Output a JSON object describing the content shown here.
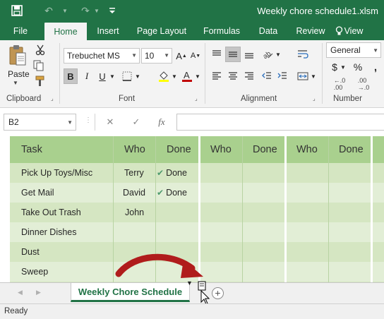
{
  "titlebar": {
    "document_title": "Weekly chore schedule1.xlsm",
    "icons": [
      "save-icon",
      "undo-icon",
      "redo-icon",
      "customize-qat-icon"
    ]
  },
  "ribbon_tabs": [
    "File",
    "Home",
    "Insert",
    "Page Layout",
    "Formulas",
    "Data",
    "Review",
    "View"
  ],
  "active_tab": "Home",
  "ribbon": {
    "clipboard": {
      "label": "Clipboard",
      "paste_label": "Paste"
    },
    "font": {
      "label": "Font",
      "font_name": "Trebuchet MS",
      "font_size": "10",
      "bold": true
    },
    "alignment": {
      "label": "Alignment"
    },
    "number": {
      "label": "Number",
      "format": "General"
    }
  },
  "formula_bar": {
    "name_box": "B2",
    "fx_label": "fx",
    "formula": ""
  },
  "sheet": {
    "headers": [
      "Task",
      "Who",
      "Done",
      "Who",
      "Done",
      "Who",
      "Done"
    ],
    "rows": [
      {
        "task": "Pick Up Toys/Misc",
        "who": "Terry",
        "done": "Done"
      },
      {
        "task": "Get Mail",
        "who": "David",
        "done": "Done"
      },
      {
        "task": "Take Out Trash",
        "who": "John",
        "done": ""
      },
      {
        "task": "Dinner Dishes",
        "who": "",
        "done": ""
      },
      {
        "task": "Dust",
        "who": "",
        "done": ""
      },
      {
        "task": "Sweep",
        "who": "",
        "done": ""
      }
    ]
  },
  "sheet_tabs": {
    "active": "Weekly Chore Schedule",
    "add_label": "+"
  },
  "status": {
    "text": "Ready"
  },
  "colors": {
    "accent": "#217346",
    "grid_band": "#d5e6c2",
    "arrow": "#b01c1c"
  }
}
